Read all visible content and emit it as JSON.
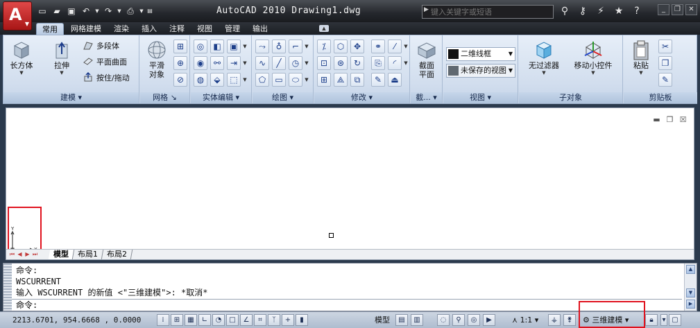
{
  "app": {
    "logo_letter": "A",
    "window_title": "AutoCAD 2010   Drawing1.dwg",
    "search_placeholder": "键入关键字或短语"
  },
  "tabs": [
    {
      "label": "常用",
      "active": true
    },
    {
      "label": "网格建模",
      "active": false
    },
    {
      "label": "渲染",
      "active": false
    },
    {
      "label": "插入",
      "active": false
    },
    {
      "label": "注释",
      "active": false
    },
    {
      "label": "视图",
      "active": false
    },
    {
      "label": "管理",
      "active": false
    },
    {
      "label": "输出",
      "active": false
    }
  ],
  "ribbon": {
    "modeling": {
      "title": "建模",
      "box": "长方体",
      "extrude": "拉伸",
      "polysolid": "多段体",
      "planar_surface": "平面曲面",
      "presspull": "按住/拖动"
    },
    "mesh": {
      "title": "网格",
      "smooth_object_l1": "平滑",
      "smooth_object_l2": "对象"
    },
    "solid_editing": {
      "title": "实体编辑"
    },
    "draw": {
      "title": "绘图"
    },
    "modify": {
      "title": "修改"
    },
    "section": {
      "title": "截...",
      "section_plane_l1": "截面",
      "section_plane_l2": "平面"
    },
    "view": {
      "title": "视图",
      "visual_style": "二维线框",
      "saved_view": "未保存的视图"
    },
    "subobject": {
      "title": "子对象",
      "no_filter": "无过滤器",
      "move_gizmo": "移动小控件"
    },
    "clipboard": {
      "title": "剪贴板",
      "paste": "粘贴"
    }
  },
  "drawing": {
    "ucs_y": "Y",
    "ucs_x": "X",
    "layout_tabs": [
      {
        "label": "模型",
        "active": true
      },
      {
        "label": "布局1",
        "active": false
      },
      {
        "label": "布局2",
        "active": false
      }
    ]
  },
  "command": {
    "history": [
      "命令:",
      "WSCURRENT",
      "输入 WSCURRENT 的新值 <\"三维建模\">: *取消*"
    ],
    "prompt": "命令:"
  },
  "status": {
    "coordinates": "2213.6701, 954.6668 , 0.0000",
    "model_label": "模型",
    "annotation_scale": "1:1",
    "workspace": "三维建模"
  },
  "colors": {
    "highlight": "#e0121e",
    "ribbon_bg": "#d2deee",
    "titlebar": "#24272c"
  }
}
